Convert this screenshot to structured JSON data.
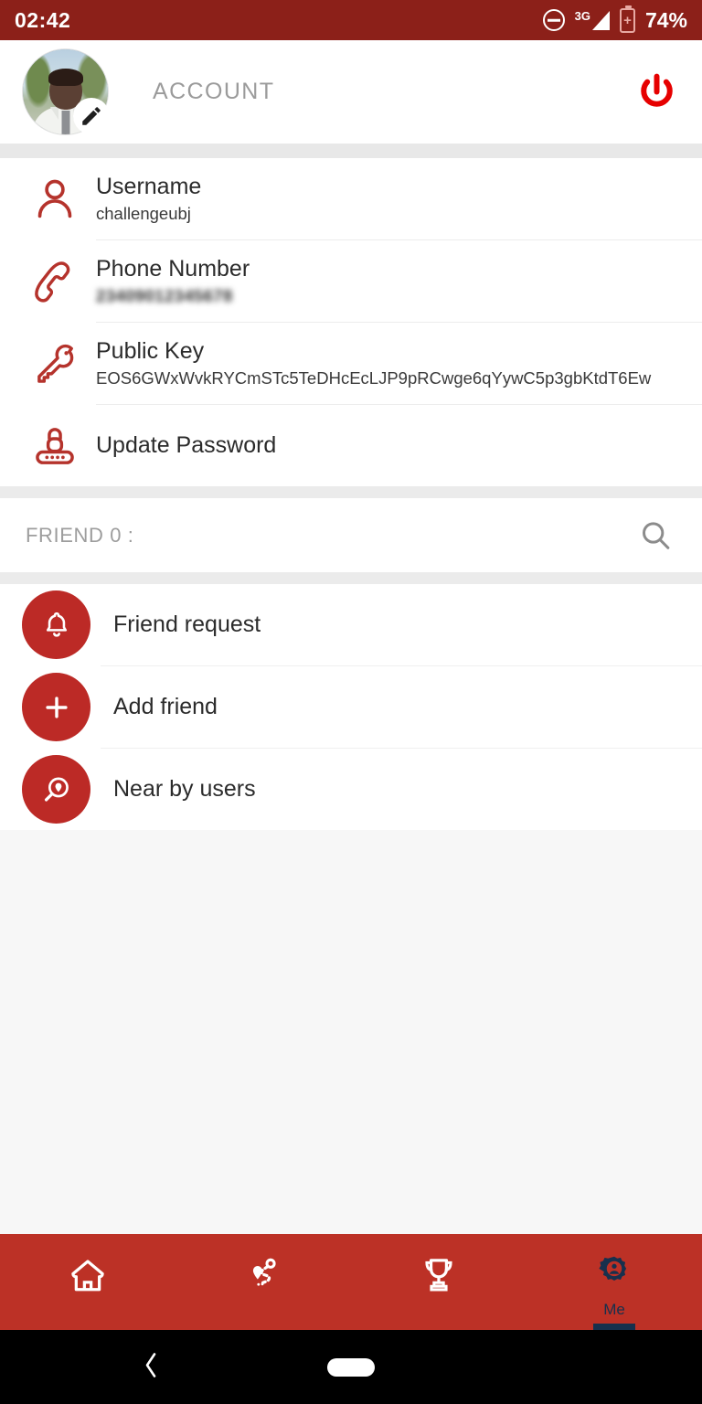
{
  "status_bar": {
    "time": "02:42",
    "battery_percent": "74%",
    "network": "3G",
    "dnd_icon": "do-not-disturb-icon",
    "battery_icon": "battery-charging-icon",
    "signal_icon": "signal-bars-icon",
    "background_color": "#8c2019"
  },
  "header": {
    "title": "ACCOUNT",
    "avatar_icon": "user-avatar-photo",
    "edit_badge_icon": "pencil-edit-icon",
    "power_icon": "power-logout-icon",
    "power_color": "#e60000",
    "title_color": "#9b9b9b"
  },
  "account": {
    "rows": [
      {
        "label": "Username",
        "value": "challengeubj",
        "icon": "person-icon",
        "blurred": false
      },
      {
        "label": "Phone Number",
        "value": "23409012345678",
        "icon": "phone-handset-icon",
        "blurred": true
      },
      {
        "label": "Public Key",
        "value": "EOS6GWxWvkRYCmSTc5TeDHcEcLJP9pRCwge6qYywC5p3gbKtdT6Ew",
        "icon": "key-icon",
        "blurred": false
      },
      {
        "label": "Update Password",
        "value": "",
        "icon": "password-lock-icon",
        "blurred": false
      }
    ],
    "icon_color": "#b5332c"
  },
  "friend_section": {
    "header_label": "FRIEND 0 :",
    "search_icon": "search-icon",
    "actions": [
      {
        "label": "Friend request",
        "icon": "bell-notification-icon"
      },
      {
        "label": "Add friend",
        "icon": "plus-icon"
      },
      {
        "label": "Near by users",
        "icon": "location-search-icon"
      }
    ],
    "circle_color": "#bc2a26"
  },
  "bottom_nav": {
    "background_color": "#bc3126",
    "active_color": "#17304d",
    "items": [
      {
        "label": "",
        "icon": "home-icon",
        "active": false
      },
      {
        "label": "",
        "icon": "route-map-icon",
        "active": false
      },
      {
        "label": "",
        "icon": "trophy-icon",
        "active": false
      },
      {
        "label": "Me",
        "icon": "account-gear-icon",
        "active": true
      }
    ]
  },
  "android_nav": {
    "back_icon": "back-chevron-icon",
    "home_pill_icon": "home-pill-icon"
  }
}
